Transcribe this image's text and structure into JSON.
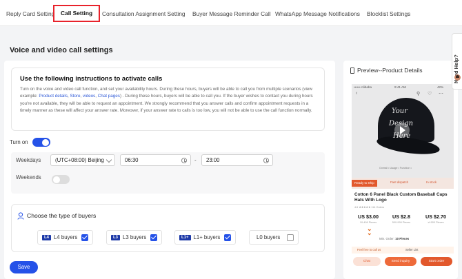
{
  "tabs": [
    {
      "label": "Reply Card Setting",
      "active": false
    },
    {
      "label": "Call Setting",
      "active": true
    },
    {
      "label": "Consultation Assignment Setting",
      "active": false
    },
    {
      "label": "Buyer Message Reminder Call",
      "active": false
    },
    {
      "label": "WhatsApp Message Notifications",
      "active": false
    },
    {
      "label": "Blocklist Settings",
      "active": false
    }
  ],
  "section_title": "Voice and video call settings",
  "instructions": {
    "title": "Use the following instructions to activate calls",
    "text_1": "Turn on the voice and video call function, and set your availability hours. During these hours, buyers will be able to call you from multiple scenarios   (view example:",
    "link_product": "Product details",
    "link_store": "Store",
    "link_videos": "videos",
    "link_chat": "Chat pages",
    "text_2": ") . During these hours, buyers will be able to call you. If the buyer wishes to contact you during hours you're not available, they will be able to request an appointment. We strongly recommend that you answer calls and confirm appointment requests in a timely manner as these will affect your answer rate. Moreover, if your answer rate to calls is too low, you will not be able to use the call function normally."
  },
  "turn_on": {
    "label": "Turn on",
    "enabled": true
  },
  "schedule": {
    "weekdays_label": "Weekdays",
    "timezone": "(UTC+08:00) Beijing",
    "start_time": "06:30",
    "separator": "-",
    "end_time": "23:00",
    "weekends_label": "Weekends",
    "weekends_enabled": false
  },
  "buyers": {
    "title": "Choose the type of buyers",
    "options": [
      {
        "badge": "L4",
        "label": "L4 buyers",
        "checked": true
      },
      {
        "badge": "L3",
        "label": "L3 buyers",
        "checked": true
      },
      {
        "badge": "L1+",
        "label": "L1+ buyers",
        "checked": true
      },
      {
        "badge": "",
        "label": "L0 buyers",
        "checked": false
      }
    ]
  },
  "save_label": "Save",
  "preview": {
    "title": "Preview--Product Details",
    "phone": {
      "carrier": "•••••• Alibaba",
      "clock": "9:41 AM",
      "battery": "42%",
      "cap_text": [
        "Your",
        "Design",
        "Here"
      ],
      "thumb_labels": "Overall • Usage • Function •",
      "ready_to_ship": "Ready to Ship",
      "fast_dispatch": "Fast dispatch",
      "in_stock": "In stock",
      "product_title": "Cotton 6 Panel Black Custom Baseball Caps Hats With Logo",
      "rating_line": "4.6 ★★★★★  114 Orders",
      "prices": [
        {
          "value": "US $3.00",
          "qty": "10-499 Pieces"
        },
        {
          "value": "US $2.8",
          "qty": "500-999 Pieces"
        },
        {
          "value": "US $2.70",
          "qty": "≥1000 Pieces"
        }
      ],
      "min_order_label": "Min. Order:",
      "min_order_value": "10 Pieces",
      "feel_free": "Feel free to call us",
      "seller_list": "Seller List",
      "chat_btn": "Chat",
      "inquiry_btn": "Send inquiry",
      "order_btn": "Start order"
    }
  },
  "help_tab": {
    "label": "Need Help?"
  },
  "colors": {
    "accent": "#2552e8",
    "active_tab_border": "#e8222b",
    "preview_orange": "#e2582c"
  }
}
